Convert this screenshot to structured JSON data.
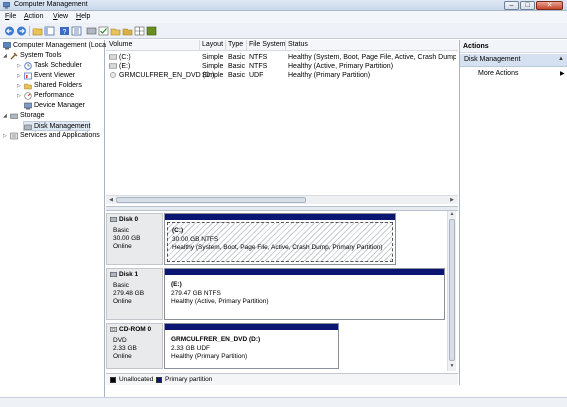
{
  "window": {
    "title": "Computer Management"
  },
  "menu": [
    {
      "label": "File",
      "underline": "F",
      "rest": "ile"
    },
    {
      "label": "Action",
      "underline": "A",
      "rest": "ction"
    },
    {
      "label": "View",
      "underline": "V",
      "rest": "iew"
    },
    {
      "label": "Help",
      "underline": "H",
      "rest": "elp"
    }
  ],
  "tree": {
    "root": "Computer Management (Local",
    "system_tools": "System Tools",
    "task_scheduler": "Task Scheduler",
    "event_viewer": "Event Viewer",
    "shared_folders": "Shared Folders",
    "performance": "Performance",
    "device_manager": "Device Manager",
    "storage": "Storage",
    "disk_management": "Disk Management",
    "services": "Services and Applications"
  },
  "volumes": {
    "headers": [
      "Volume",
      "Layout",
      "Type",
      "File System",
      "Status"
    ],
    "rows": [
      {
        "volume": "(C:)",
        "layout": "Simple",
        "type": "Basic",
        "fs": "NTFS",
        "status": "Healthy (System, Boot, Page File, Active, Crash Dump, Pri"
      },
      {
        "volume": "(E:)",
        "layout": "Simple",
        "type": "Basic",
        "fs": "NTFS",
        "status": "Healthy (Active, Primary Partition)"
      },
      {
        "volume": "GRMCULFRER_EN_DVD (D:)",
        "layout": "Simple",
        "type": "Basic",
        "fs": "UDF",
        "status": "Healthy (Primary Partition)"
      }
    ]
  },
  "disks": [
    {
      "name": "Disk 0",
      "kind": "Basic",
      "size": "30.00 GB",
      "state": "Online",
      "part_name": "(C:)",
      "part_size": "30.00 GB NTFS",
      "part_status": "Healthy (System, Boot, Page File, Active, Crash Dump, Primary Partition)"
    },
    {
      "name": "Disk 1",
      "kind": "Basic",
      "size": "279.48 GB",
      "state": "Online",
      "part_name": "(E:)",
      "part_size": "279.47 GB NTFS",
      "part_status": "Healthy (Active, Primary Partition)"
    },
    {
      "name": "CD-ROM 0",
      "kind": "DVD",
      "size": "2.33 GB",
      "state": "Online",
      "part_name": "GRMCULFRER_EN_DVD  (D:)",
      "part_size": "2.33 GB UDF",
      "part_status": "Healthy (Primary Partition)"
    }
  ],
  "legend": [
    {
      "label": "Unallocated",
      "color": "#000000"
    },
    {
      "label": "Primary partition",
      "color": "#0b1572"
    }
  ],
  "actions": {
    "header": "Actions",
    "section": "Disk Management",
    "more": "More Actions"
  }
}
